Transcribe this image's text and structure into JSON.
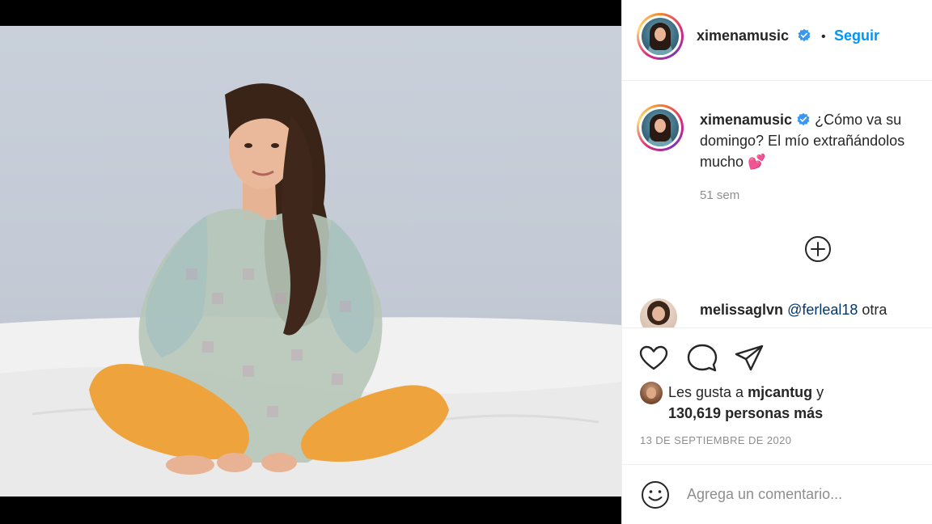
{
  "post": {
    "image_alt": "Woman in a sheer checked dress and yellow tights sitting cross-legged on a white bed",
    "colors": {
      "accent": "#0095f6",
      "text": "#262626",
      "muted": "#8e8e8e",
      "verified": "#3897f0",
      "heart": "#e1306c"
    }
  },
  "header": {
    "username": "ximenamusic",
    "separator": "•",
    "follow_label": "Seguir",
    "verified_icon": "verified-badge-icon"
  },
  "caption": {
    "username": "ximenamusic",
    "text": "¿Cómo va su domingo? El mío extrañándolos mucho 💕",
    "time_ago": "51 sem"
  },
  "load_more_icon": "plus-circle-icon",
  "comments": [
    {
      "username": "melissaglvn",
      "mention": "@ferleal18",
      "text": "otra"
    }
  ],
  "actions": {
    "like_icon": "heart-icon",
    "comment_icon": "comment-bubble-icon",
    "share_icon": "paper-plane-icon",
    "likes_prefix": "Les gusta a",
    "liked_by": "mjcantug",
    "likes_and": "y",
    "likes_count": "130,619 personas más",
    "date": "13 DE SEPTIEMBRE DE 2020"
  },
  "add_comment": {
    "emoji_icon": "emoji-smile-icon",
    "placeholder": "Agrega un comentario..."
  }
}
